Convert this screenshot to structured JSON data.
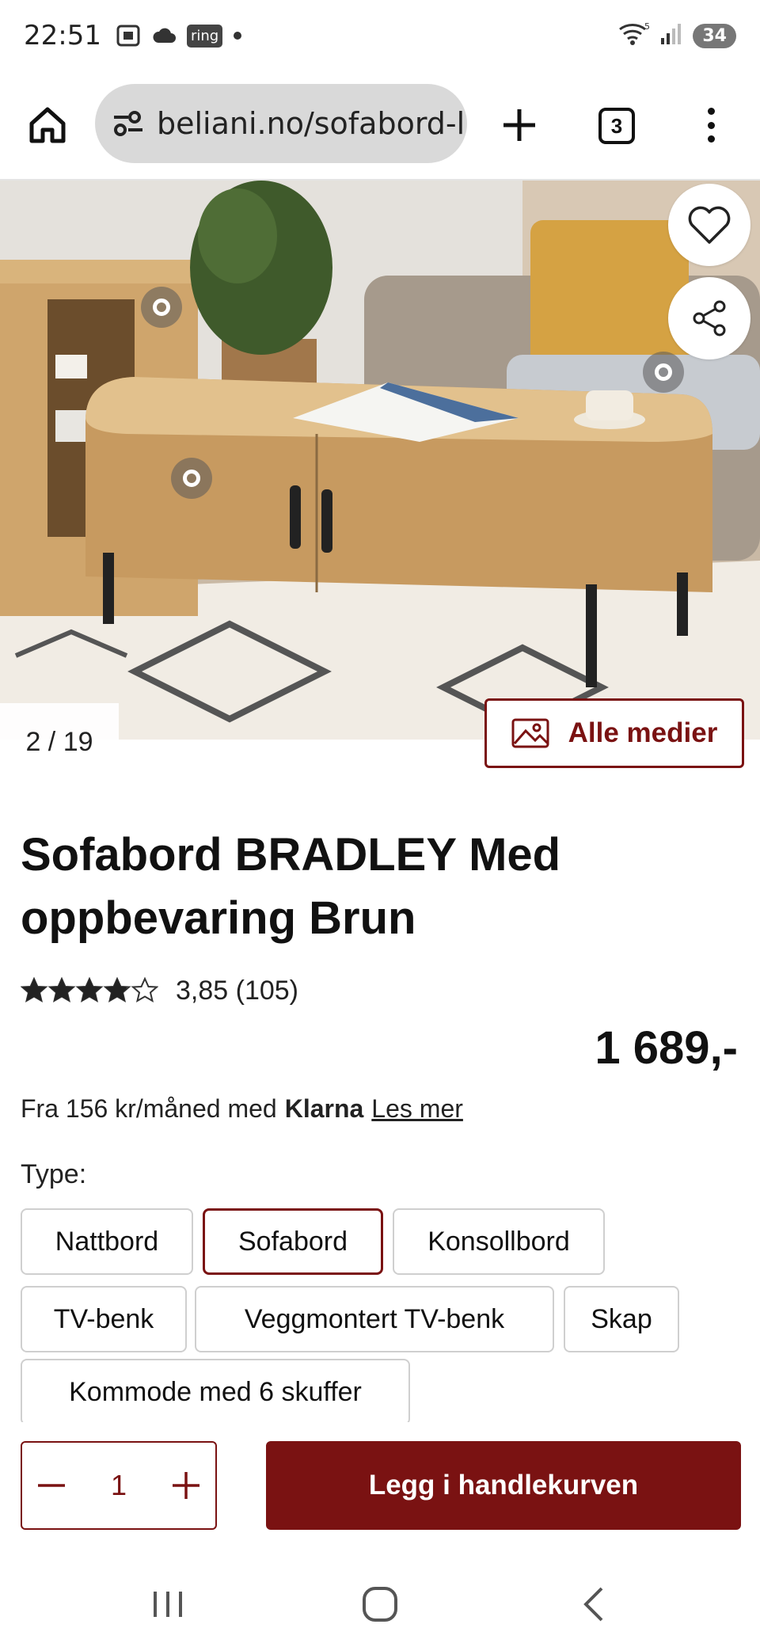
{
  "status_bar": {
    "time": "22:51",
    "ring_label": "ring",
    "battery": "34",
    "wifi_badge": "5"
  },
  "browser": {
    "url": "beliani.no/sofabord-l",
    "tab_count": "3"
  },
  "gallery": {
    "counter": "2 / 19",
    "all_media_label": "Alle medier"
  },
  "product": {
    "title": "Sofabord BRADLEY Med oppbevaring Brun",
    "rating_value": 3.85,
    "rating_text": "3,85 (105)",
    "price": "1 689,-",
    "klarna_prefix": "Fra 156 kr/måned med",
    "klarna_brand": "Klarna",
    "klarna_link": "Les mer"
  },
  "type_selector": {
    "label": "Type:",
    "options": [
      "Nattbord",
      "Sofabord",
      "Konsollbord",
      "TV-benk",
      "Veggmontert TV-benk",
      "Skap",
      "Kommode med 6 skuffer"
    ],
    "selected": "Sofabord"
  },
  "cart": {
    "quantity": "1",
    "add_label": "Legg i handlekurven"
  },
  "colors": {
    "accent": "#7a1212",
    "url_pill": "#d9d9d9"
  },
  "icons": [
    "home-icon",
    "site-settings-icon",
    "plus-icon",
    "tabs-icon",
    "menu-icon",
    "heart-icon",
    "share-icon",
    "image-icon",
    "star-icon",
    "minus-icon",
    "recents-icon",
    "home-circle-icon",
    "back-icon"
  ]
}
